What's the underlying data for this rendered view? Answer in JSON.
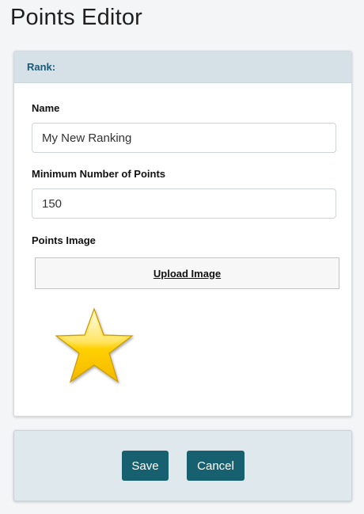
{
  "page": {
    "title": "Points Editor"
  },
  "rank_card": {
    "header": "Rank:",
    "name_label": "Name",
    "name_value": "My New Ranking",
    "min_points_label": "Minimum Number of Points",
    "min_points_value": "150",
    "points_image_label": "Points Image",
    "upload_button_label": "Upload Image",
    "image_icon": "star-icon"
  },
  "footer": {
    "save_label": "Save",
    "cancel_label": "Cancel"
  },
  "colors": {
    "accent": "#17606f",
    "header_bg": "#d5e1e7",
    "header_text": "#1c5a73",
    "footer_bg": "#dee8ed",
    "star_fill": "#ffd21a"
  }
}
